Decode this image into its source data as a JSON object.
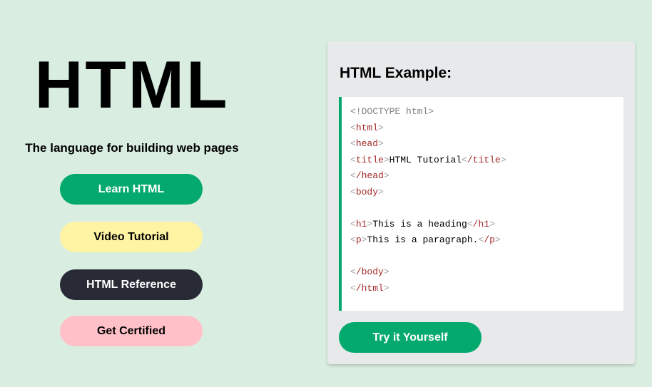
{
  "hero": {
    "title": "HTML",
    "subtitle": "The language for building web pages"
  },
  "buttons": {
    "learn": "Learn HTML",
    "video": "Video Tutorial",
    "reference": "HTML Reference",
    "certified": "Get Certified"
  },
  "example": {
    "heading": "HTML Example:",
    "code_lines": [
      {
        "kind": "doctype",
        "text": "<!DOCTYPE html>"
      },
      {
        "kind": "tag",
        "tag": "html"
      },
      {
        "kind": "tag",
        "tag": "head"
      },
      {
        "kind": "element",
        "tag": "title",
        "content": "HTML Tutorial"
      },
      {
        "kind": "tag",
        "tag": "/head"
      },
      {
        "kind": "tag",
        "tag": "body"
      },
      {
        "kind": "blank"
      },
      {
        "kind": "element",
        "tag": "h1",
        "content": "This is a heading"
      },
      {
        "kind": "element",
        "tag": "p",
        "content": "This is a paragraph."
      },
      {
        "kind": "blank"
      },
      {
        "kind": "tag",
        "tag": "/body"
      },
      {
        "kind": "tag",
        "tag": "/html"
      }
    ],
    "try_button": "Try it Yourself"
  },
  "colors": {
    "background": "#d9eee1",
    "green": "#04aa6d",
    "yellow": "#fff4a3",
    "dark": "#282a35",
    "pink": "#ffc0c7",
    "card": "#e7e9eb",
    "tag": "#a52a2a",
    "bracket": "#a0a0a0"
  }
}
